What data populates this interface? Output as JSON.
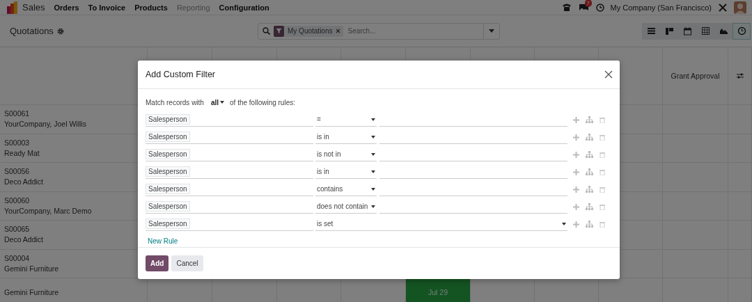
{
  "navbar": {
    "app": "Sales",
    "menus": [
      {
        "label": "Orders",
        "muted": false
      },
      {
        "label": "To Invoice",
        "muted": false
      },
      {
        "label": "Products",
        "muted": false
      },
      {
        "label": "Reporting",
        "muted": true
      },
      {
        "label": "Configuration",
        "muted": false
      }
    ],
    "messages_badge": "7",
    "company": "My Company (San Francisco)"
  },
  "control_panel": {
    "title": "Quotations",
    "search": {
      "facet": "My Quotations",
      "placeholder": "Search..."
    },
    "views": [
      {
        "kind": "list",
        "selected": false
      },
      {
        "kind": "kanban",
        "selected": false
      },
      {
        "kind": "calendar",
        "selected": false
      },
      {
        "kind": "pivot",
        "selected": false
      },
      {
        "kind": "graph",
        "selected": false
      },
      {
        "kind": "activity",
        "selected": true
      }
    ]
  },
  "list": {
    "column_10": "Grant Approval",
    "rows": [
      {
        "reference": "S00061",
        "customer": "YourCompany, Joel Willis"
      },
      {
        "reference": "S00003",
        "customer": "Ready Mat"
      },
      {
        "reference": "S00056",
        "customer": "Deco Addict"
      },
      {
        "reference": "S00060",
        "customer": "YourCompany, Marc Demo"
      },
      {
        "reference": "S00065",
        "customer": "Deco Addict"
      },
      {
        "reference": "S00004",
        "customer": "Gemini Furniture"
      },
      {
        "customer": "Gemini Furniture",
        "deadline": "Jul 29"
      }
    ]
  },
  "dialog": {
    "title": "Add Custom Filter",
    "match_prefix": "Match records with",
    "match_mode": "all",
    "match_suffix": "of the following rules:",
    "rules": [
      {
        "field": "Salesperson",
        "operator": "=",
        "kind": "value"
      },
      {
        "field": "Salesperson",
        "operator": "is in",
        "kind": "value"
      },
      {
        "field": "Salesperson",
        "operator": "is not in",
        "kind": "value"
      },
      {
        "field": "Salesperson",
        "operator": "is in",
        "kind": "value"
      },
      {
        "field": "Salesperson",
        "operator": "contains",
        "kind": "value"
      },
      {
        "field": "Salesperson",
        "operator": "does not contain",
        "kind": "value"
      },
      {
        "field": "Salesperson",
        "operator": "is set",
        "kind": "novalue"
      }
    ],
    "new_rule": "New Rule",
    "buttons": [
      {
        "label": "Add",
        "kind": "primary"
      },
      {
        "label": "Cancel",
        "kind": "secondary"
      }
    ]
  }
}
